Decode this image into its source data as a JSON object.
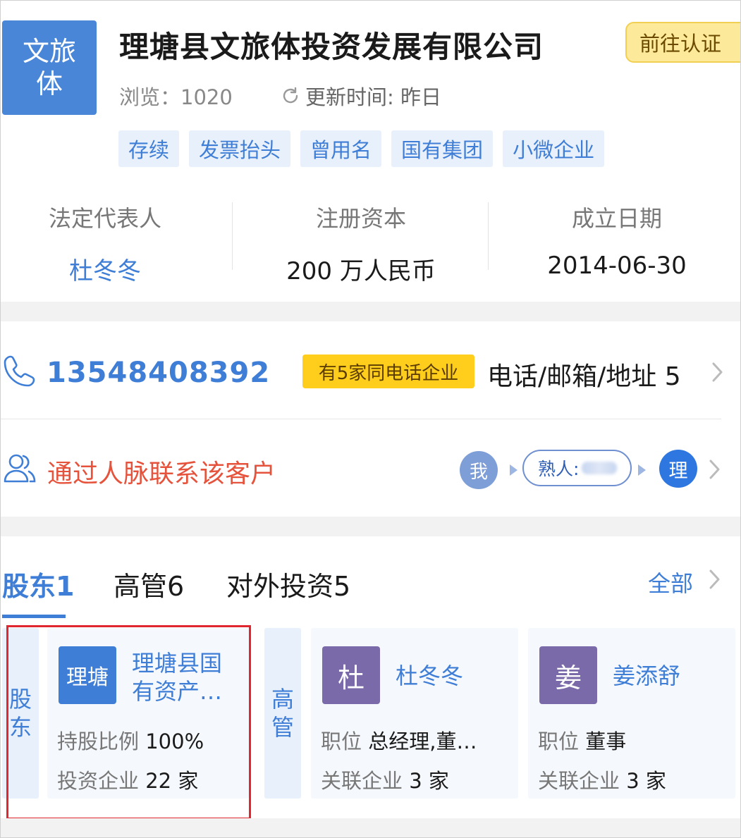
{
  "header": {
    "logo_text": "文旅体",
    "company_name": "理塘县文旅体投资发展有限公司",
    "cert_button": "前往认证",
    "views": "浏览：1020",
    "update_time": "更新时间: 昨日",
    "tags": [
      "存续",
      "发票抬头",
      "曾用名",
      "国有集团",
      "小微企业"
    ]
  },
  "stats": {
    "legal_rep_label": "法定代表人",
    "legal_rep_value": "杜冬冬",
    "capital_label": "注册资本",
    "capital_value": "200 万人民币",
    "founded_label": "成立日期",
    "founded_value": "2014-06-30"
  },
  "contact": {
    "phone": "13548408392",
    "same_phone_badge": "有5家同电话企业",
    "summary": "电话/邮箱/地址 5"
  },
  "network": {
    "text": "通过人脉联系该客户",
    "me": "我",
    "acquaintance": "熟人:",
    "target": "理"
  },
  "tabs": {
    "shareholders": "股东1",
    "executives": "高管6",
    "investments": "对外投资5",
    "all": "全部"
  },
  "cards": {
    "shareholder_label": "股东",
    "executive_label": "高管",
    "shareholder": {
      "avatar": "理塘",
      "name": "理塘县国有资产…",
      "ratio_label": "持股比例",
      "ratio_value": "100%",
      "invest_label": "投资企业",
      "invest_value": "22 家"
    },
    "exec1": {
      "avatar": "杜",
      "name": "杜冬冬",
      "position_label": "职位",
      "position_value": "总经理,董…",
      "related_label": "关联企业",
      "related_value": "3 家"
    },
    "exec2": {
      "avatar": "姜",
      "name": "姜添舒",
      "position_label": "职位",
      "position_value": "董事",
      "related_label": "关联企业",
      "related_value": "3 家"
    }
  },
  "colors": {
    "accent_blue": "#3f7ed6",
    "network_red": "#e6533c",
    "badge_yellow": "#ffcd1c",
    "highlight_red": "#e0262e"
  }
}
